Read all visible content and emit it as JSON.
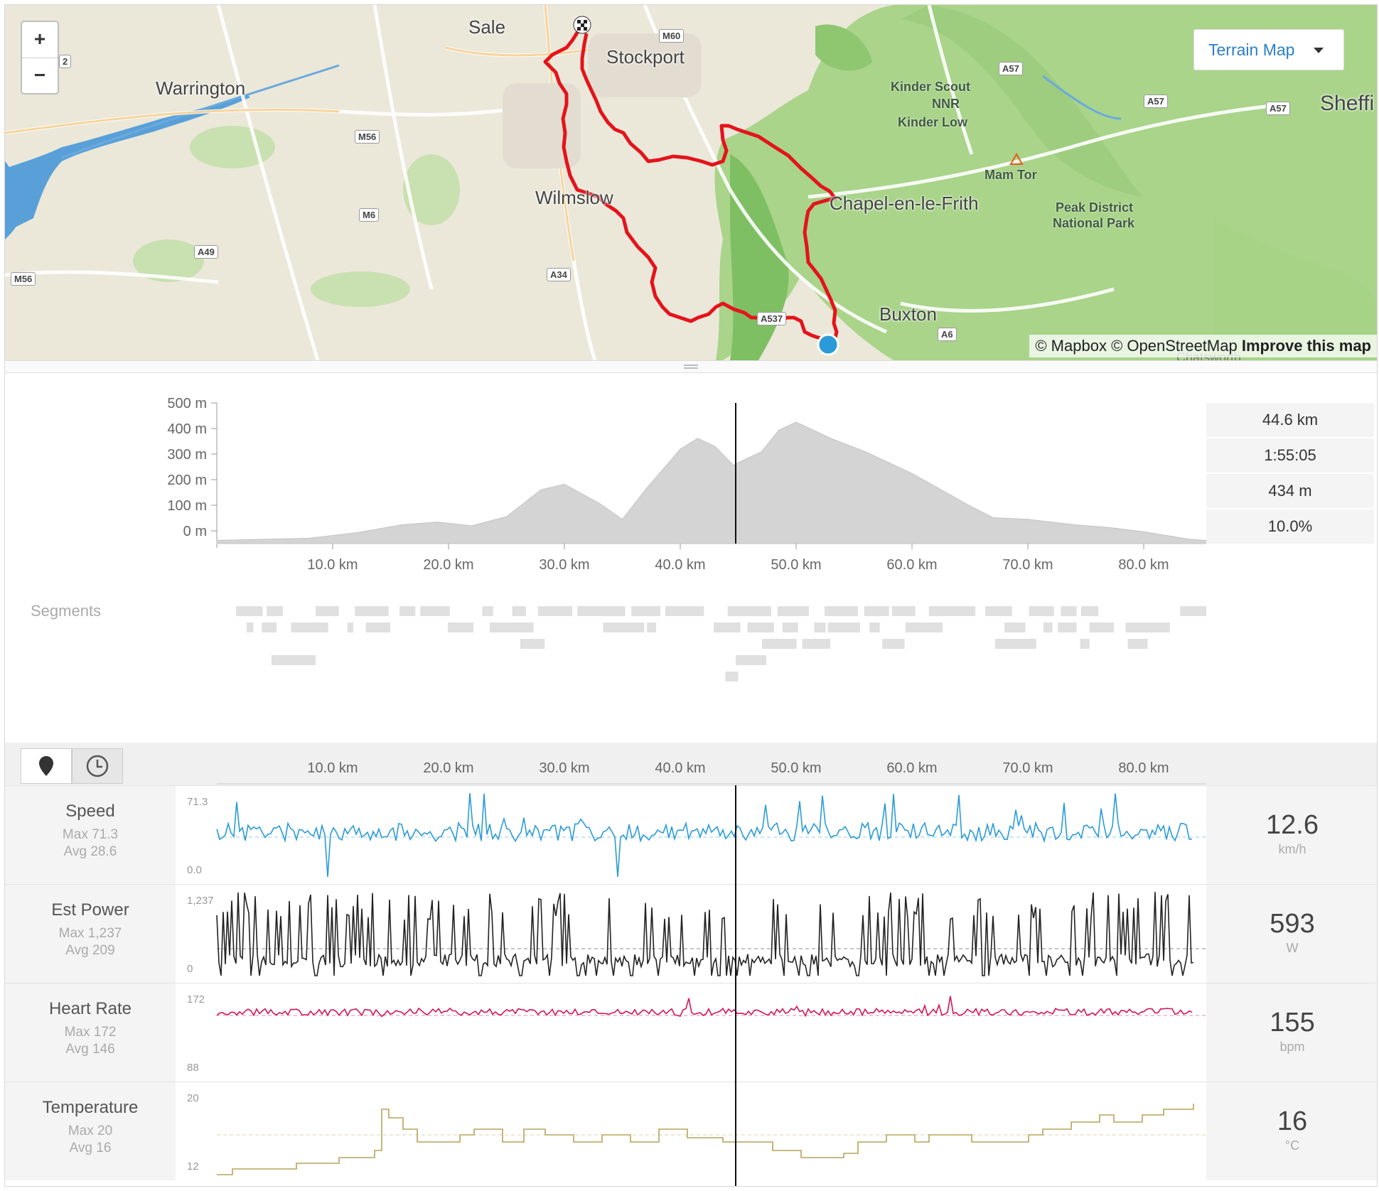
{
  "map": {
    "layer_button": "Terrain Map",
    "zoom_in": "+",
    "zoom_out": "−",
    "attribution_mapbox": "© Mapbox",
    "attribution_osm": "© OpenStreetMap",
    "attribution_improve": "Improve this map",
    "labels": {
      "sale": "Sale",
      "stockport": "Stockport",
      "warrington": "Warrington",
      "wilmslow": "Wilmslow",
      "chapel": "Chapel-en-le-Frith",
      "buxton": "Buxton",
      "sheffield": "Sheffi",
      "kinder": "Kinder Scout",
      "nnr": "NNR",
      "kinder_low": "Kinder Low",
      "mam_tor": "Mam Tor",
      "peak1": "Peak District",
      "peak2": "National Park",
      "chatsworth": "Chatsworth"
    },
    "shields": {
      "m60": "M60",
      "a57a": "A57",
      "a57b": "A57",
      "a57c": "A57",
      "m56a": "M56",
      "m6": "M6",
      "a49": "A49",
      "m56b": "M56",
      "a34": "A34",
      "a6": "A6",
      "m2": "2",
      "a537": "A537"
    },
    "route_color": "#e5131b"
  },
  "elevation": {
    "y_ticks": [
      "500 m",
      "400 m",
      "300 m",
      "200 m",
      "100 m",
      "0 m"
    ],
    "x_ticks": [
      "10.0 km",
      "20.0 km",
      "30.0 km",
      "40.0 km",
      "50.0 km",
      "60.0 km",
      "70.0 km",
      "80.0 km"
    ],
    "stats": {
      "distance": "44.6 km",
      "time": "1:55:05",
      "elevation": "434 m",
      "grade": "10.0%"
    }
  },
  "segments_label": "Segments",
  "streams": {
    "x_ticks": [
      "10.0 km",
      "20.0 km",
      "30.0 km",
      "40.0 km",
      "50.0 km",
      "60.0 km",
      "70.0 km",
      "80.0 km"
    ],
    "rows": {
      "speed": {
        "name": "Speed",
        "max": "Max 71.3",
        "avg": "Avg 28.6",
        "ymax": "71.3",
        "ymin": "0.0",
        "value": "12.6",
        "unit": "km/h",
        "color": "#2a9bd8"
      },
      "power": {
        "name": "Est Power",
        "max": "Max 1,237",
        "avg": "Avg 209",
        "ymax": "1,237",
        "ymin": "0",
        "value": "593",
        "unit": "W",
        "color": "#222222"
      },
      "hr": {
        "name": "Heart Rate",
        "max": "Max 172",
        "avg": "Avg 146",
        "ymax": "172",
        "ymin": "88",
        "value": "155",
        "unit": "bpm",
        "color": "#d4145a"
      },
      "temp": {
        "name": "Temperature",
        "max": "Max 20",
        "avg": "Avg 16",
        "ymax": "20",
        "ymin": "12",
        "value": "16",
        "unit": "°C",
        "color": "#b5a45a"
      }
    }
  },
  "icons": [
    "map-pin-icon",
    "clock-icon",
    "caret-down-icon",
    "finish-flag-icon",
    "route-start-icon",
    "drag-handle-icon",
    "peak-triangle-icon"
  ]
}
